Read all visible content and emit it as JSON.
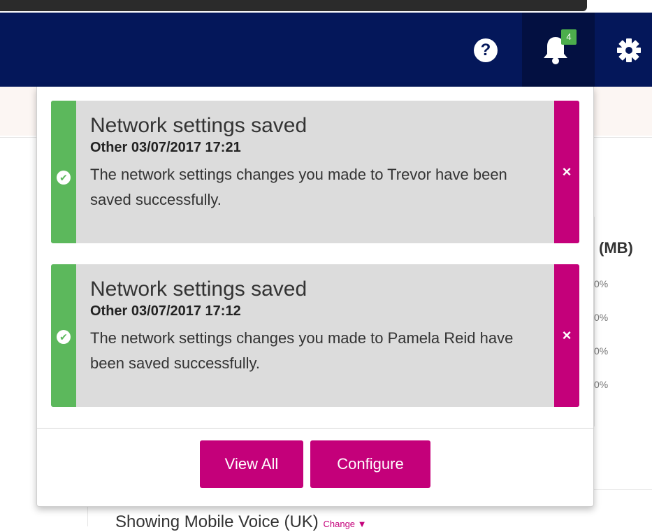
{
  "header": {
    "help_icon": "?",
    "notification_count": "4",
    "icons": [
      "help-icon",
      "bell-icon",
      "gear-icon"
    ],
    "background_color": "#04175a"
  },
  "notifications": [
    {
      "title": "Network settings saved",
      "meta": "Other 03/07/2017 17:21",
      "message": "The network settings changes you made to Trevor have been saved successfully.",
      "status_icon": "check-icon",
      "close_icon": "×"
    },
    {
      "title": "Network settings saved",
      "meta": "Other 03/07/2017 17:12",
      "message": "The network settings changes you made to Pamela Reid have been saved successfully.",
      "status_icon": "check-icon",
      "close_icon": "×"
    }
  ],
  "footer": {
    "view_all_label": "View All",
    "configure_label": "Configure"
  },
  "background": {
    "mb_heading": "(MB)",
    "percent_values": [
      "0%",
      "0%",
      "0%",
      "0%"
    ],
    "showing_text": "Showing Mobile Voice (UK)",
    "change_link": "Change ▼"
  },
  "colors": {
    "accent": "#c4007a",
    "success": "#5cb85c",
    "header": "#04175a",
    "badge": "#4cae4c"
  }
}
